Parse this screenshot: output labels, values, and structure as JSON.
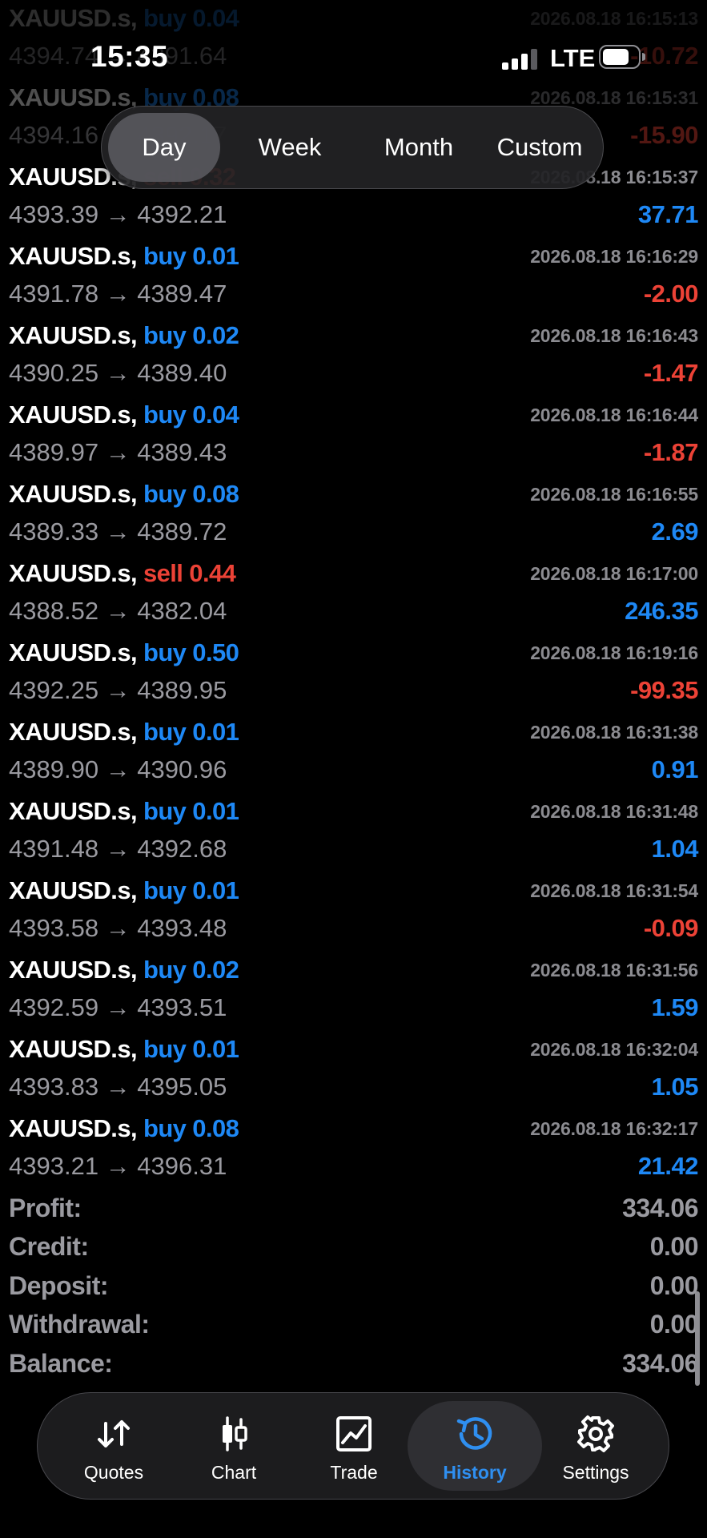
{
  "status_bar": {
    "time": "15:35",
    "network": "LTE"
  },
  "period_tabs": {
    "day": "Day",
    "week": "Week",
    "month": "Month",
    "custom": "Custom",
    "selected": "Day"
  },
  "trades": [
    {
      "symbol": "XAUUSD.s,",
      "side": "buy",
      "volume": "0.04",
      "side_text": "buy 0.04",
      "time": "2026.08.18 16:15:13",
      "prices": "4394.74 → 4391.64",
      "profit": "-10.72"
    },
    {
      "symbol": "XAUUSD.s,",
      "side": "buy",
      "volume": "0.08",
      "side_text": "buy 0.08",
      "time": "2026.08.18 16:15:31",
      "prices": "4394.16 → 4392.17",
      "profit": "-15.90"
    },
    {
      "symbol": "XAUUSD.s,",
      "side": "sell",
      "volume": "0.32",
      "side_text": "sell 0.32",
      "time": "2026.08.18 16:15:37",
      "prices": "4393.39 → 4392.21",
      "profit": "37.71"
    },
    {
      "symbol": "XAUUSD.s,",
      "side": "buy",
      "volume": "0.01",
      "side_text": "buy 0.01",
      "time": "2026.08.18 16:16:29",
      "prices": "4391.78 → 4389.47",
      "profit": "-2.00"
    },
    {
      "symbol": "XAUUSD.s,",
      "side": "buy",
      "volume": "0.02",
      "side_text": "buy 0.02",
      "time": "2026.08.18 16:16:43",
      "prices": "4390.25 → 4389.40",
      "profit": "-1.47"
    },
    {
      "symbol": "XAUUSD.s,",
      "side": "buy",
      "volume": "0.04",
      "side_text": "buy 0.04",
      "time": "2026.08.18 16:16:44",
      "prices": "4389.97 → 4389.43",
      "profit": "-1.87"
    },
    {
      "symbol": "XAUUSD.s,",
      "side": "buy",
      "volume": "0.08",
      "side_text": "buy 0.08",
      "time": "2026.08.18 16:16:55",
      "prices": "4389.33 → 4389.72",
      "profit": "2.69"
    },
    {
      "symbol": "XAUUSD.s,",
      "side": "sell",
      "volume": "0.44",
      "side_text": "sell 0.44",
      "time": "2026.08.18 16:17:00",
      "prices": "4388.52 → 4382.04",
      "profit": "246.35"
    },
    {
      "symbol": "XAUUSD.s,",
      "side": "buy",
      "volume": "0.50",
      "side_text": "buy 0.50",
      "time": "2026.08.18 16:19:16",
      "prices": "4392.25 → 4389.95",
      "profit": "-99.35"
    },
    {
      "symbol": "XAUUSD.s,",
      "side": "buy",
      "volume": "0.01",
      "side_text": "buy 0.01",
      "time": "2026.08.18 16:31:38",
      "prices": "4389.90 → 4390.96",
      "profit": "0.91"
    },
    {
      "symbol": "XAUUSD.s,",
      "side": "buy",
      "volume": "0.01",
      "side_text": "buy 0.01",
      "time": "2026.08.18 16:31:48",
      "prices": "4391.48 → 4392.68",
      "profit": "1.04"
    },
    {
      "symbol": "XAUUSD.s,",
      "side": "buy",
      "volume": "0.01",
      "side_text": "buy 0.01",
      "time": "2026.08.18 16:31:54",
      "prices": "4393.58 → 4393.48",
      "profit": "-0.09"
    },
    {
      "symbol": "XAUUSD.s,",
      "side": "buy",
      "volume": "0.02",
      "side_text": "buy 0.02",
      "time": "2026.08.18 16:31:56",
      "prices": "4392.59 → 4393.51",
      "profit": "1.59"
    },
    {
      "symbol": "XAUUSD.s,",
      "side": "buy",
      "volume": "0.01",
      "side_text": "buy 0.01",
      "time": "2026.08.18 16:32:04",
      "prices": "4393.83 → 4395.05",
      "profit": "1.05"
    },
    {
      "symbol": "XAUUSD.s,",
      "side": "buy",
      "volume": "0.08",
      "side_text": "buy 0.08",
      "time": "2026.08.18 16:32:17",
      "prices": "4393.21 → 4396.31",
      "profit": "21.42"
    }
  ],
  "summary": {
    "profit_label": "Profit:",
    "profit_value": "334.06",
    "credit_label": "Credit:",
    "credit_value": "0.00",
    "deposit_label": "Deposit:",
    "deposit_value": "0.00",
    "withdrawal_label": "Withdrawal:",
    "withdrawal_value": "0.00",
    "balance_label": "Balance:",
    "balance_value": "334.06"
  },
  "tab_bar": {
    "quotes": {
      "label": "Quotes",
      "icon": "quotes-arrows-icon"
    },
    "chart": {
      "label": "Chart",
      "icon": "candlestick-icon"
    },
    "trade": {
      "label": "Trade",
      "icon": "trade-chart-icon"
    },
    "history": {
      "label": "History",
      "icon": "history-clock-icon"
    },
    "settings": {
      "label": "Settings",
      "icon": "gear-icon"
    },
    "selected": "History"
  },
  "colors": {
    "buy": "#1e88f5",
    "sell": "#ec4236",
    "positive_profit": "#1e88f5",
    "negative_profit": "#ec4236",
    "active_tab": "#2f8ff0",
    "background": "#000000"
  }
}
